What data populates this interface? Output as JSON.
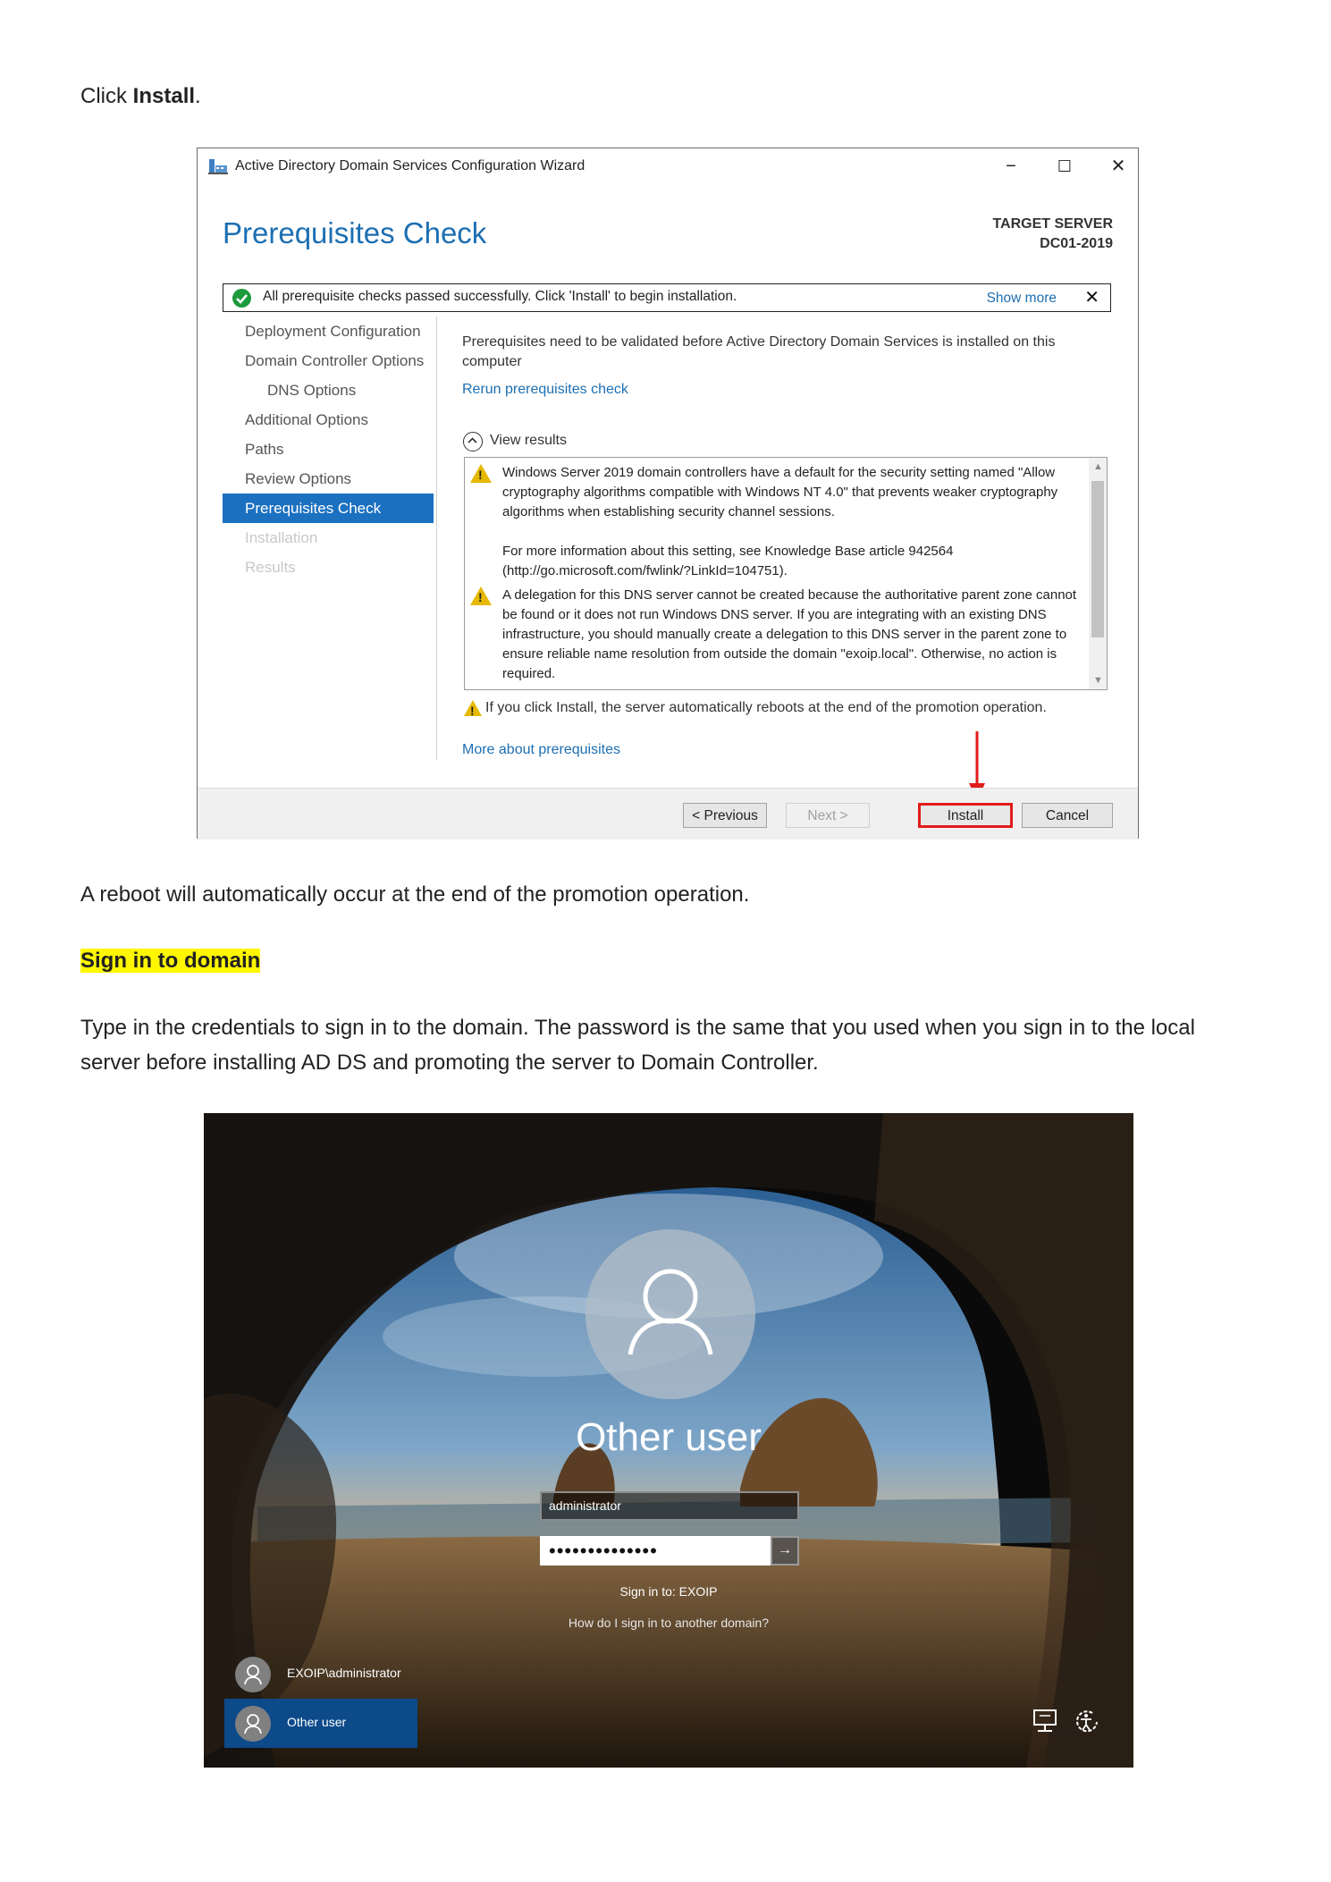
{
  "intro": {
    "prefix": "Click ",
    "bold": "Install",
    "suffix": "."
  },
  "wizard": {
    "title": "Active Directory Domain Services Configuration Wizard",
    "minimize": "−",
    "maximize": "☐",
    "close": "✕",
    "heading": "Prerequisites Check",
    "target_label": "TARGET SERVER",
    "target_name": "DC01-2019",
    "notice": {
      "text": "All prerequisite checks passed successfully.  Click 'Install' to begin installation.",
      "show_more": "Show more",
      "close": "✕"
    },
    "nav": [
      {
        "label": "Deployment Configuration",
        "state": "normal"
      },
      {
        "label": "Domain Controller Options",
        "state": "normal"
      },
      {
        "label": "DNS Options",
        "state": "sub"
      },
      {
        "label": "Additional Options",
        "state": "normal"
      },
      {
        "label": "Paths",
        "state": "normal"
      },
      {
        "label": "Review Options",
        "state": "normal"
      },
      {
        "label": "Prerequisites Check",
        "state": "active"
      },
      {
        "label": "Installation",
        "state": "disabled"
      },
      {
        "label": "Results",
        "state": "disabled"
      }
    ],
    "description": "Prerequisites need to be validated before Active Directory Domain Services is installed on this computer",
    "rerun_link": "Rerun prerequisites check",
    "view_results": "View results",
    "results": [
      {
        "text": "Windows Server 2019 domain controllers have a default for the security setting named \"Allow cryptography algorithms compatible with Windows NT 4.0\" that prevents weaker cryptography algorithms when establishing security channel sessions."
      },
      {
        "text": "For more information about this setting, see Knowledge Base article 942564 (http://go.microsoft.com/fwlink/?LinkId=104751)."
      },
      {
        "text": "A delegation for this DNS server cannot be created because the authoritative parent zone cannot be found or it does not run Windows DNS server. If you are integrating with an existing DNS infrastructure, you should manually create a delegation to this DNS server in the parent zone to ensure reliable name resolution from outside the domain \"exoip.local\". Otherwise, no action is required."
      }
    ],
    "reboot_warning": "If you click Install, the server automatically reboots at the end of the promotion operation.",
    "more_link": "More about prerequisites",
    "buttons": {
      "previous": "< Previous",
      "next": "Next >",
      "install": "Install",
      "cancel": "Cancel"
    },
    "accent_color": "#1b70c0",
    "highlight_color": "#e21b1b"
  },
  "reboot_note": "A reboot will automatically occur at the end of the promotion operation.",
  "section_heading": "Sign in to domain",
  "instructions": "Type in the credentials to sign in to the domain. The password is the same that you used when you sign in to the local server before installing AD DS and promoting the server to Domain Controller.",
  "lockscreen": {
    "user_title": "Other user",
    "username_value": "administrator",
    "password_value": "••••••••••••••",
    "submit_icon": "→",
    "sign_in_to": "Sign in to: EXOIP",
    "how_link": "How do I sign in to another domain?",
    "accounts": [
      {
        "name": "EXOIP\\administrator",
        "selected": false
      },
      {
        "name": "Other user",
        "selected": true
      }
    ]
  }
}
